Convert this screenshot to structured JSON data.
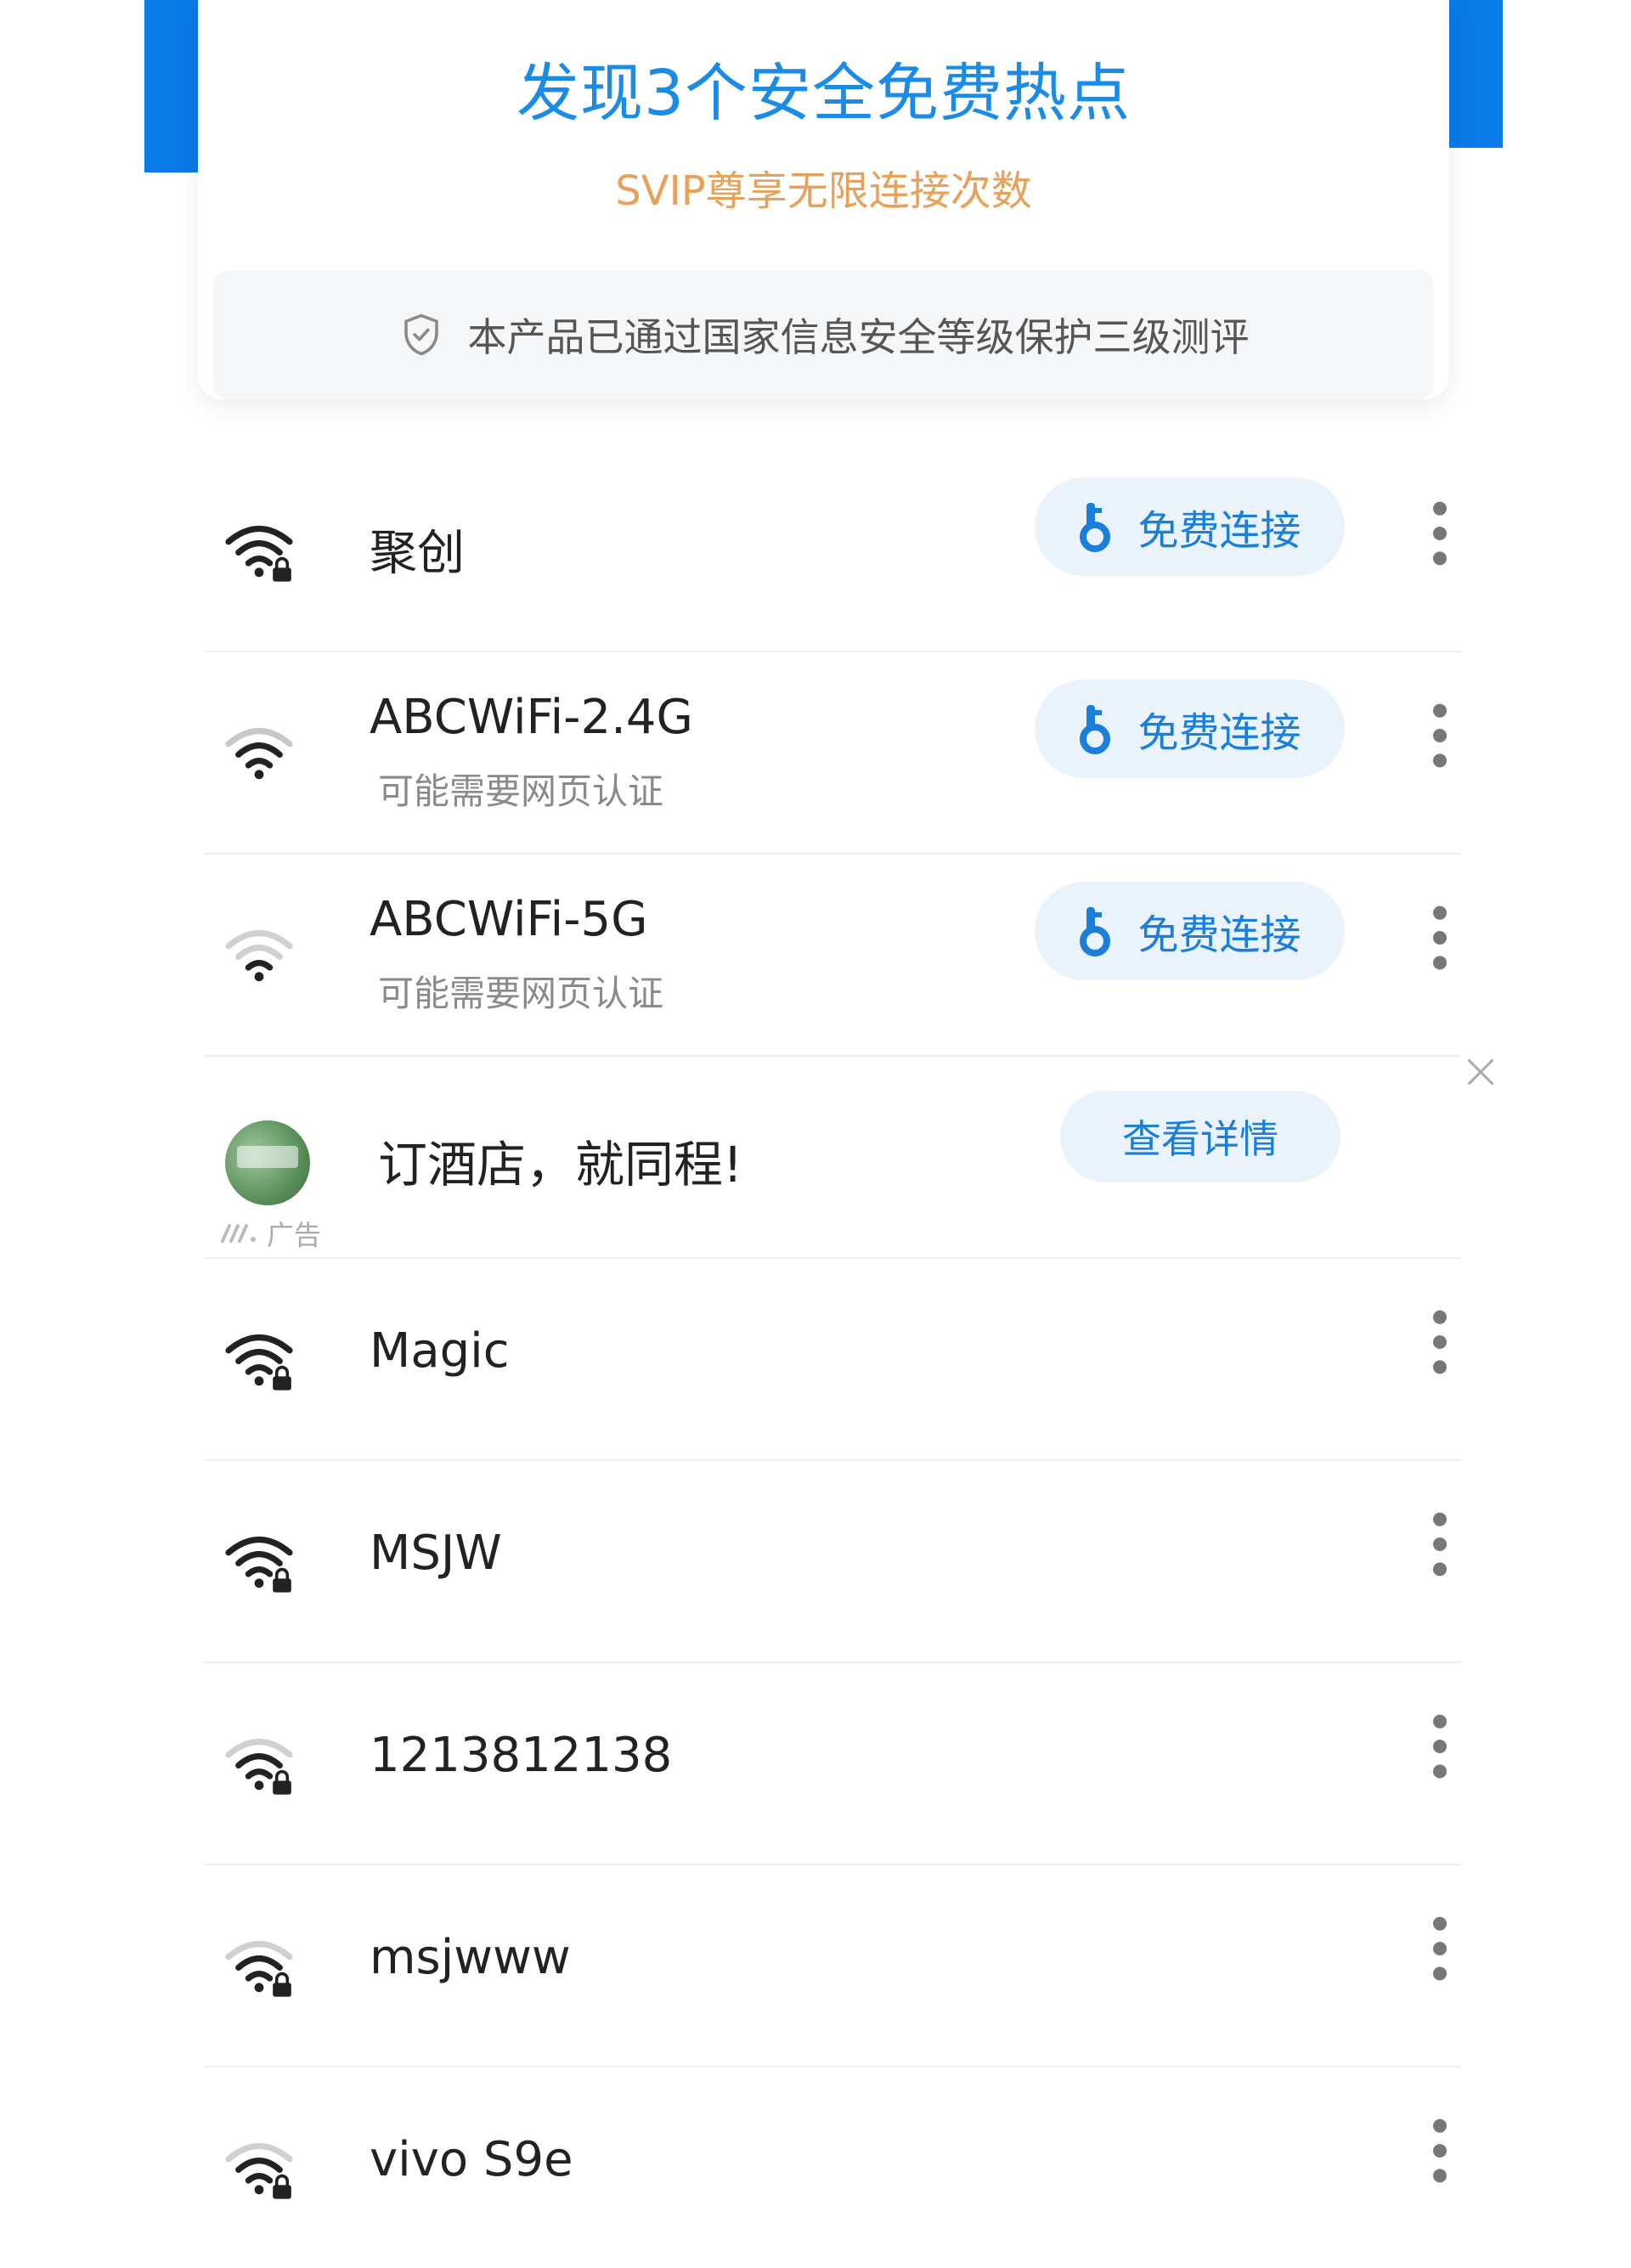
{
  "header": {
    "title": "发现3个安全免费热点",
    "subtitle": "SVIP尊享无限连接次数",
    "security_text": "本产品已通过国家信息安全等级保护三级测评"
  },
  "colors": {
    "brand_blue": "#1b8be8",
    "accent_orange": "#e8a15a",
    "button_bg": "#eaf3fb",
    "button_text": "#1b7fd9"
  },
  "free_networks": [
    {
      "name": "聚创",
      "sub": "",
      "button": "免费连接",
      "icon": "wifi-locked-icon"
    },
    {
      "name": "ABCWiFi-2.4G",
      "sub": "可能需要网页认证",
      "button": "免费连接",
      "icon": "wifi-icon"
    },
    {
      "name": "ABCWiFi-5G",
      "sub": "可能需要网页认证",
      "button": "免费连接",
      "icon": "wifi-weak-icon"
    }
  ],
  "ad": {
    "title": "订酒店，就同程!",
    "label": "广告",
    "button": "查看详情"
  },
  "locked_networks": [
    {
      "name": "Magic",
      "icon": "wifi-locked-icon"
    },
    {
      "name": "MSJW",
      "icon": "wifi-locked-icon"
    },
    {
      "name": "1213812138",
      "icon": "wifi-locked-icon"
    },
    {
      "name": "msjwww",
      "icon": "wifi-locked-icon"
    },
    {
      "name": "vivo S9e",
      "icon": "wifi-locked-icon"
    }
  ]
}
